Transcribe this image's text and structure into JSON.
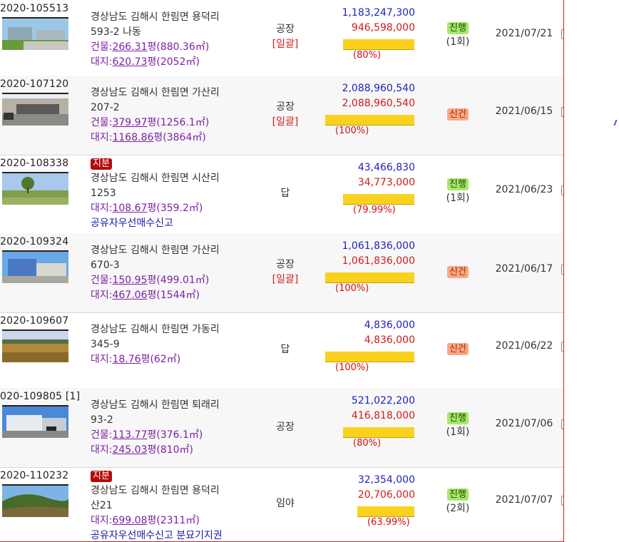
{
  "colors": {
    "appraisal": "#2222bb",
    "min_price": "#d21a1a",
    "bar": "#fad21e",
    "go_badge": "#a8e66a",
    "new_badge": "#f8a986",
    "share_tag": "#b30b0b"
  },
  "items": [
    {
      "case_no": "2020-105513",
      "address1": "경상남도 김해시 한림면 용덕리",
      "address2": "593-2 나동",
      "building_label": "건물:",
      "building_py": "266.31",
      "building_unit": "평",
      "building_m2": "(880.36㎡)",
      "land_label": "대지:",
      "land_py": "620.73",
      "land_unit": "평",
      "land_m2": "(2052㎡)",
      "note": "",
      "share_tag": "",
      "use": "공장",
      "lump": "[일괄]",
      "appraisal": "1,183,247,300",
      "min_price": "946,598,000",
      "ratio": "(80%)",
      "ratio_value": 80,
      "status": "진행",
      "round": "(1회)",
      "date": "2021/07/21"
    },
    {
      "case_no": "2020-107120",
      "address1": "경상남도 김해시 한림면 가산리",
      "address2": "207-2",
      "building_label": "건물:",
      "building_py": "379.97",
      "building_unit": "평",
      "building_m2": "(1256.1㎡)",
      "land_label": "대지:",
      "land_py": "1168.86",
      "land_unit": "평",
      "land_m2": "(3864㎡)",
      "note": "",
      "share_tag": "",
      "use": "공장",
      "lump": "[일괄]",
      "appraisal": "2,088,960,540",
      "min_price": "2,088,960,540",
      "ratio": "(100%)",
      "ratio_value": 100,
      "status": "신건",
      "round": "",
      "date": "2021/06/15"
    },
    {
      "case_no": "2020-108338",
      "address1": "경상남도 김해시 한림면 시산리",
      "address2": "1253",
      "building_label": "",
      "building_py": "",
      "building_unit": "",
      "building_m2": "",
      "land_label": "대지:",
      "land_py": "108.67",
      "land_unit": "평",
      "land_m2": "(359.2㎡)",
      "note": "공유자우선매수신고",
      "share_tag": "지분",
      "use": "답",
      "lump": "",
      "appraisal": "43,466,830",
      "min_price": "34,773,000",
      "ratio": "(79.99%)",
      "ratio_value": 79.99,
      "status": "진행",
      "round": "(1회)",
      "date": "2021/06/23"
    },
    {
      "case_no": "2020-109324",
      "address1": "경상남도 김해시 한림면 가산리",
      "address2": "670-3",
      "building_label": "건물:",
      "building_py": "150.95",
      "building_unit": "평",
      "building_m2": "(499.01㎡)",
      "land_label": "대지:",
      "land_py": "467.06",
      "land_unit": "평",
      "land_m2": "(1544㎡)",
      "note": "",
      "share_tag": "",
      "use": "공장",
      "lump": "[일괄]",
      "appraisal": "1,061,836,000",
      "min_price": "1,061,836,000",
      "ratio": "(100%)",
      "ratio_value": 100,
      "status": "신건",
      "round": "",
      "date": "2021/06/17"
    },
    {
      "case_no": "2020-109607",
      "address1": "경상남도 김해시 한림면 가동리",
      "address2": "345-9",
      "building_label": "",
      "building_py": "",
      "building_unit": "",
      "building_m2": "",
      "land_label": "대지:",
      "land_py": "18.76",
      "land_unit": "평",
      "land_m2": "(62㎡)",
      "note": "",
      "share_tag": "",
      "use": "답",
      "lump": "",
      "appraisal": "4,836,000",
      "min_price": "4,836,000",
      "ratio": "(100%)",
      "ratio_value": 100,
      "status": "신건",
      "round": "",
      "date": "2021/06/22"
    },
    {
      "case_no": "020-109805 [1]",
      "address1": "경상남도 김해시 한림면 퇴래리",
      "address2": "93-2",
      "building_label": "건물:",
      "building_py": "113.77",
      "building_unit": "평",
      "building_m2": "(376.1㎡)",
      "land_label": "대지:",
      "land_py": "245.03",
      "land_unit": "평",
      "land_m2": "(810㎡)",
      "note": "",
      "share_tag": "",
      "use": "공장",
      "lump": "",
      "appraisal": "521,022,200",
      "min_price": "416,818,000",
      "ratio": "(80%)",
      "ratio_value": 80,
      "status": "진행",
      "round": "(1회)",
      "date": "2021/07/06"
    },
    {
      "case_no": "2020-110232",
      "address1": "경상남도 김해시 한림면 용덕리",
      "address2": "산21",
      "building_label": "",
      "building_py": "",
      "building_unit": "",
      "building_m2": "",
      "land_label": "대지:",
      "land_py": "699.08",
      "land_unit": "평",
      "land_m2": "(2311㎡)",
      "note": "공유자우선매수신고 분묘기지권",
      "share_tag": "지분",
      "use": "임야",
      "lump": "",
      "appraisal": "32,354,000",
      "min_price": "20,706,000",
      "ratio": "(63.99%)",
      "ratio_value": 63.99,
      "status": "진행",
      "round": "(2회)",
      "date": "2021/07/07"
    }
  ]
}
